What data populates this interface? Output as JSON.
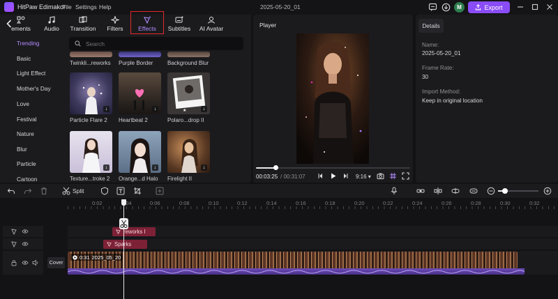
{
  "app": {
    "name": "HitPaw Edimakor",
    "menu": [
      "File",
      "Settings",
      "Help"
    ],
    "project_title": "2025-05-20_01",
    "avatar_letter": "M",
    "export_label": "Export",
    "accent": "#8a4cf6"
  },
  "tabs": [
    {
      "label": "ements",
      "icon": "elements-icon"
    },
    {
      "label": "Audio",
      "icon": "music-note-icon"
    },
    {
      "label": "Transition",
      "icon": "transition-icon"
    },
    {
      "label": "Filters",
      "icon": "sparkle-icon"
    },
    {
      "label": "Effects",
      "icon": "effects-icon",
      "active": true
    },
    {
      "label": "Subtitles",
      "icon": "subtitles-icon"
    },
    {
      "label": "AI Avatar",
      "icon": "ai-avatar-icon"
    }
  ],
  "categories": [
    "Trending",
    "Basic",
    "Light Effect",
    "Mother's Day",
    "Love",
    "Festival",
    "Nature",
    "Blur",
    "Particle",
    "Cartoon"
  ],
  "search": {
    "placeholder": "Search",
    "value": ""
  },
  "effects": [
    {
      "label": "Twinkli...reworks"
    },
    {
      "label": "Purple Border"
    },
    {
      "label": "Background Blur"
    },
    {
      "label": "Particle Flare 2"
    },
    {
      "label": "Heartbeat 2"
    },
    {
      "label": "Polaro...drop II"
    },
    {
      "label": "Texture...troke 2"
    },
    {
      "label": "Orange...d Halo"
    },
    {
      "label": "Firelight II"
    }
  ],
  "player": {
    "label": "Player",
    "current_time": "00:03:25",
    "total_time": "/ 00:31:07",
    "speed": "9:16",
    "progress": 0.13
  },
  "details": {
    "tab": "Details",
    "fields": [
      {
        "label": "Name:",
        "value": "2025-05-20_01"
      },
      {
        "label": "Frame Rate:",
        "value": "30"
      },
      {
        "label": "Import Method:",
        "value": "Keep in original location"
      }
    ]
  },
  "toolbar": {
    "split_label": "Split"
  },
  "timeline": {
    "ruler": [
      "0:02",
      "0:04",
      "0:06",
      "0:08",
      "0:10",
      "0:12",
      "0:14",
      "0:16",
      "0:18",
      "0:20",
      "0:22",
      "0:24",
      "0:26",
      "0:28",
      "0:30",
      "0:32"
    ],
    "fx_clips": [
      {
        "label": "Twinkling Fireworks I",
        "shown": "reworks I"
      },
      {
        "label": "Sparks"
      }
    ],
    "video_clip": {
      "duration": "0:31",
      "name": "2025_05_20"
    },
    "cover_label": "Cover"
  }
}
